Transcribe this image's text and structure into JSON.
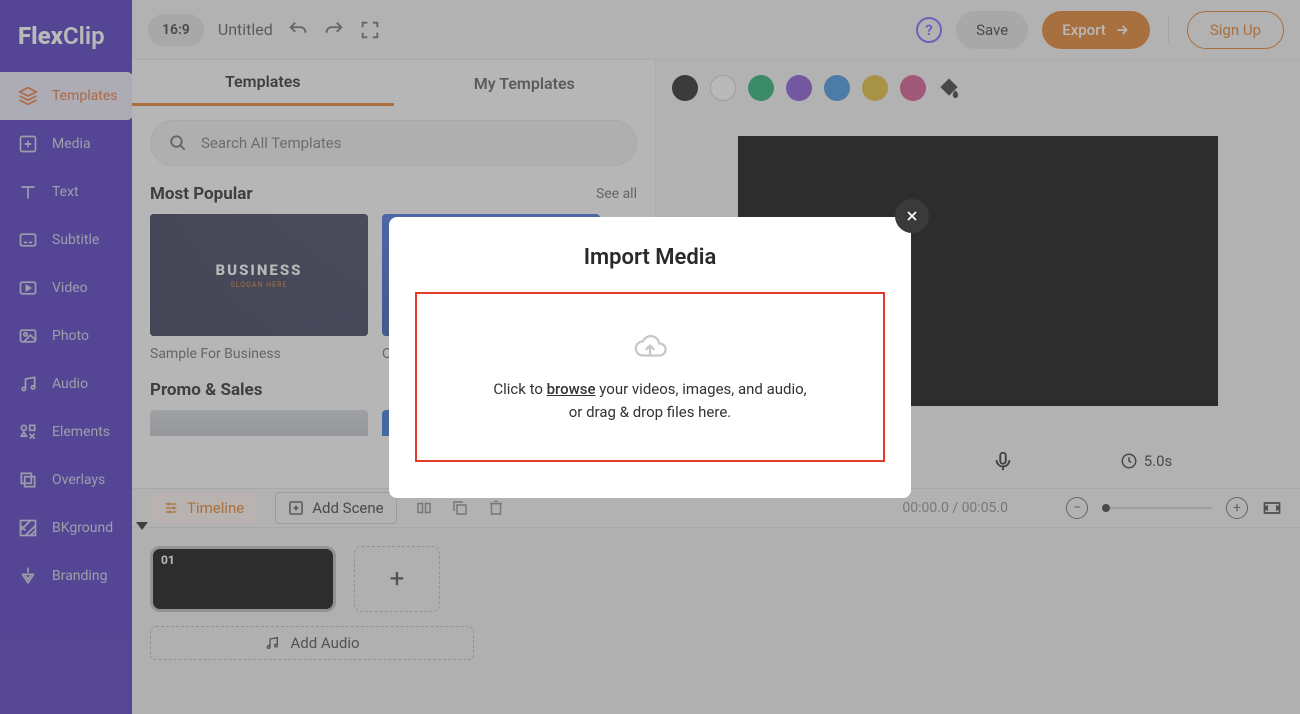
{
  "logo": {
    "part1": "Flex",
    "part2": "Clip"
  },
  "sidebar": {
    "items": [
      {
        "label": "Templates"
      },
      {
        "label": "Media"
      },
      {
        "label": "Text"
      },
      {
        "label": "Subtitle"
      },
      {
        "label": "Video"
      },
      {
        "label": "Photo"
      },
      {
        "label": "Audio"
      },
      {
        "label": "Elements"
      },
      {
        "label": "Overlays"
      },
      {
        "label": "BKground"
      },
      {
        "label": "Branding"
      }
    ]
  },
  "topbar": {
    "ratio": "16:9",
    "title": "Untitled",
    "save": "Save",
    "export": "Export",
    "signup": "Sign Up"
  },
  "panel": {
    "tabs": {
      "templates": "Templates",
      "my": "My Templates"
    },
    "search_placeholder": "Search All Templates",
    "section1": {
      "title": "Most Popular",
      "see_all": "See all"
    },
    "tpl1_caption": "Sample For Business",
    "tpl1_text": "BUSINESS",
    "tpl1_sub": "SLOGAN HERE",
    "tpl2_caption_partial": "C",
    "section2": {
      "title": "Promo & Sales"
    }
  },
  "colors": [
    "#1a1a1a",
    "#ffffff",
    "#1aab6e",
    "#7d4fd1",
    "#3a8ee0",
    "#e0b82c",
    "#d24f8a"
  ],
  "player": {
    "duration": "5.0s"
  },
  "timeline_bar": {
    "timeline": "Timeline",
    "add_scene": "Add Scene",
    "time": "00:00.0 / 00:05.0"
  },
  "timeline": {
    "clip_num": "01",
    "add_audio": "Add Audio"
  },
  "modal": {
    "title": "Import Media",
    "text_pre": "Click to ",
    "browse": "browse",
    "text_post": " your videos, images, and audio, or drag & drop files here."
  }
}
